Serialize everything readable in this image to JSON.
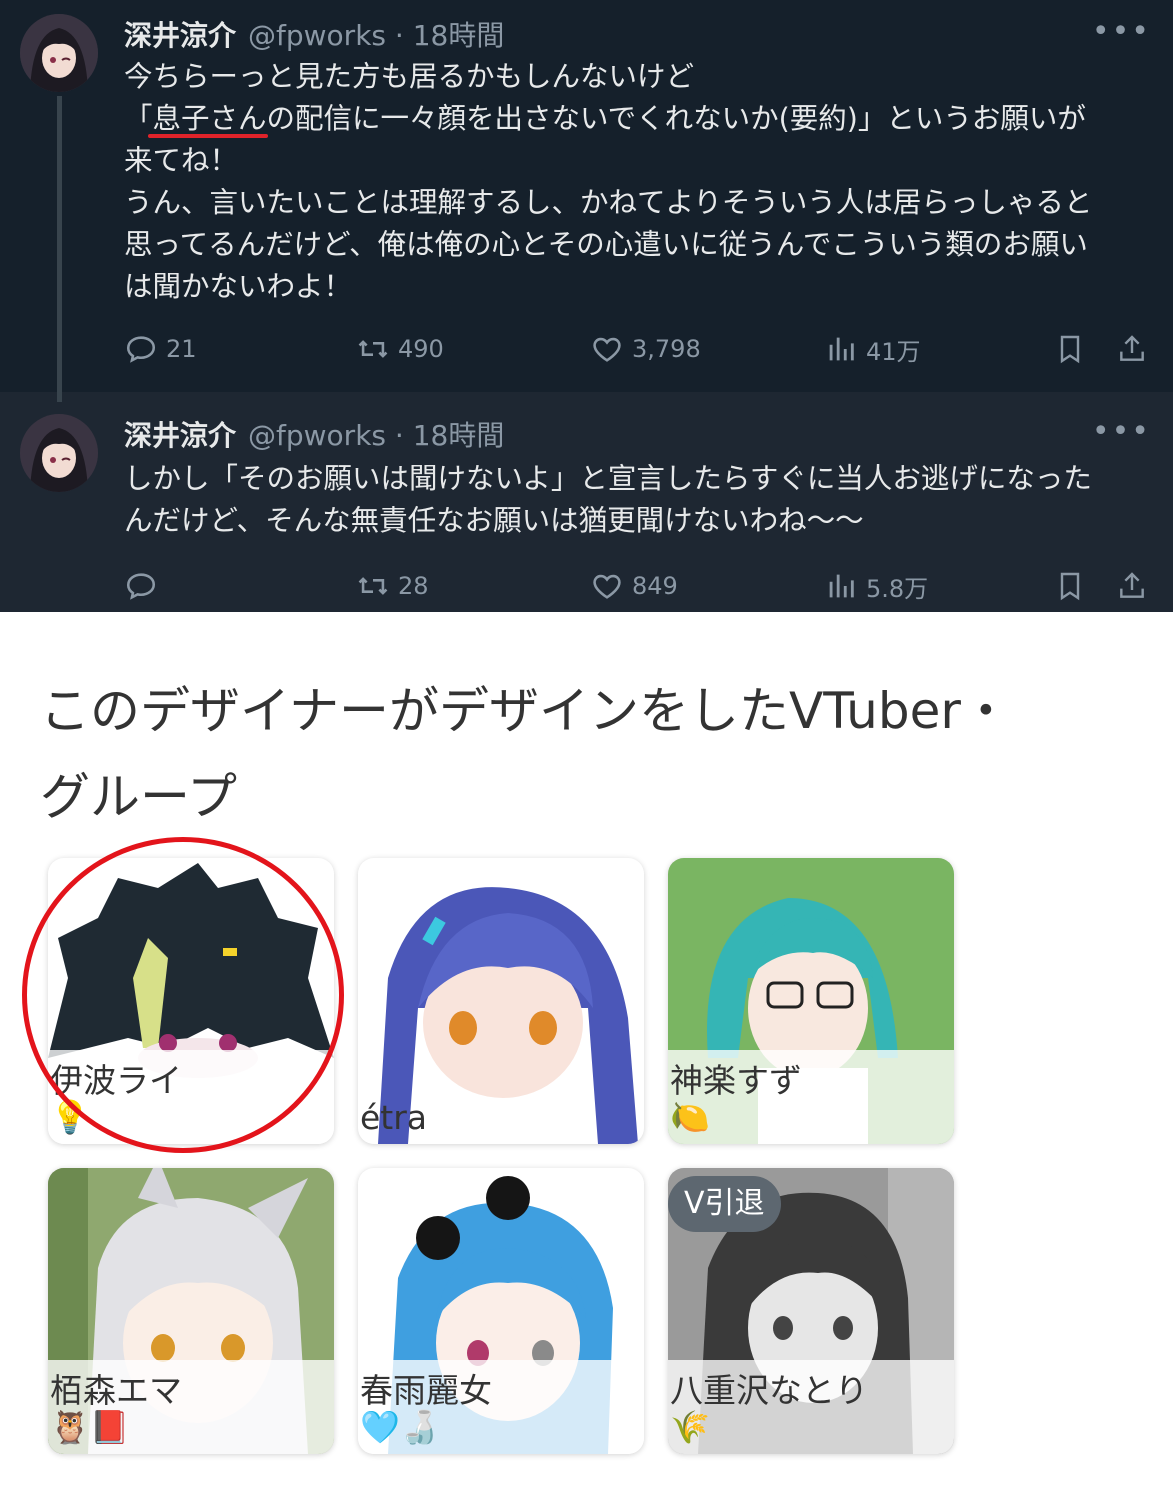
{
  "tweets": [
    {
      "author": "深井涼介",
      "handle": "@fpworks",
      "time": "18時間",
      "more": "•••",
      "lines": [
        "今ちらーっと見た方も居るかもしんないけど",
        "「息子さんの配信に一々顔を出さないでくれないか(要約)」というお願いが",
        "来てね！",
        "うん、言いたいことは理解するし、かねてよりそういう人は居らっしゃると",
        "思ってるんだけど、俺は俺の心とその心遣いに従うんでこういう類のお願い",
        "は聞かないわよ！"
      ],
      "stats": {
        "replies": "21",
        "retweets": "490",
        "likes": "3,798",
        "views": "41万"
      }
    },
    {
      "author": "深井涼介",
      "handle": "@fpworks",
      "time": "18時間",
      "more": "•••",
      "lines": [
        "しかし「そのお願いは聞けないよ」と宣言したらすぐに当人お逃げになった",
        "んだけど、そんな無責任なお願いは猶更聞けないわね～～"
      ],
      "stats": {
        "replies": "",
        "retweets": "28",
        "likes": "849",
        "views": "5.8万"
      }
    }
  ],
  "designer_section": {
    "title_line1": "このデザイナーがデザインをしたVTuber・",
    "title_line2": "グループ"
  },
  "vtubers": [
    {
      "name": "伊波ライ",
      "emoji": "💡",
      "badge": ""
    },
    {
      "name": "étra",
      "emoji": "",
      "badge": ""
    },
    {
      "name": "神楽すず",
      "emoji": "🍋",
      "badge": ""
    },
    {
      "name": "栢森エマ",
      "emoji": "🦉📕",
      "badge": ""
    },
    {
      "name": "春雨麗女",
      "emoji": "🩵🍶",
      "badge": ""
    },
    {
      "name": "八重沢なとり",
      "emoji": "🌾",
      "badge": "V引退"
    }
  ],
  "colors": {
    "dark_bg": "#15202b",
    "highlight": "#e3141b",
    "muted": "#8b98a5"
  },
  "icons": [
    "reply-icon",
    "retweet-icon",
    "like-icon",
    "views-icon",
    "bookmark-icon",
    "share-icon"
  ]
}
